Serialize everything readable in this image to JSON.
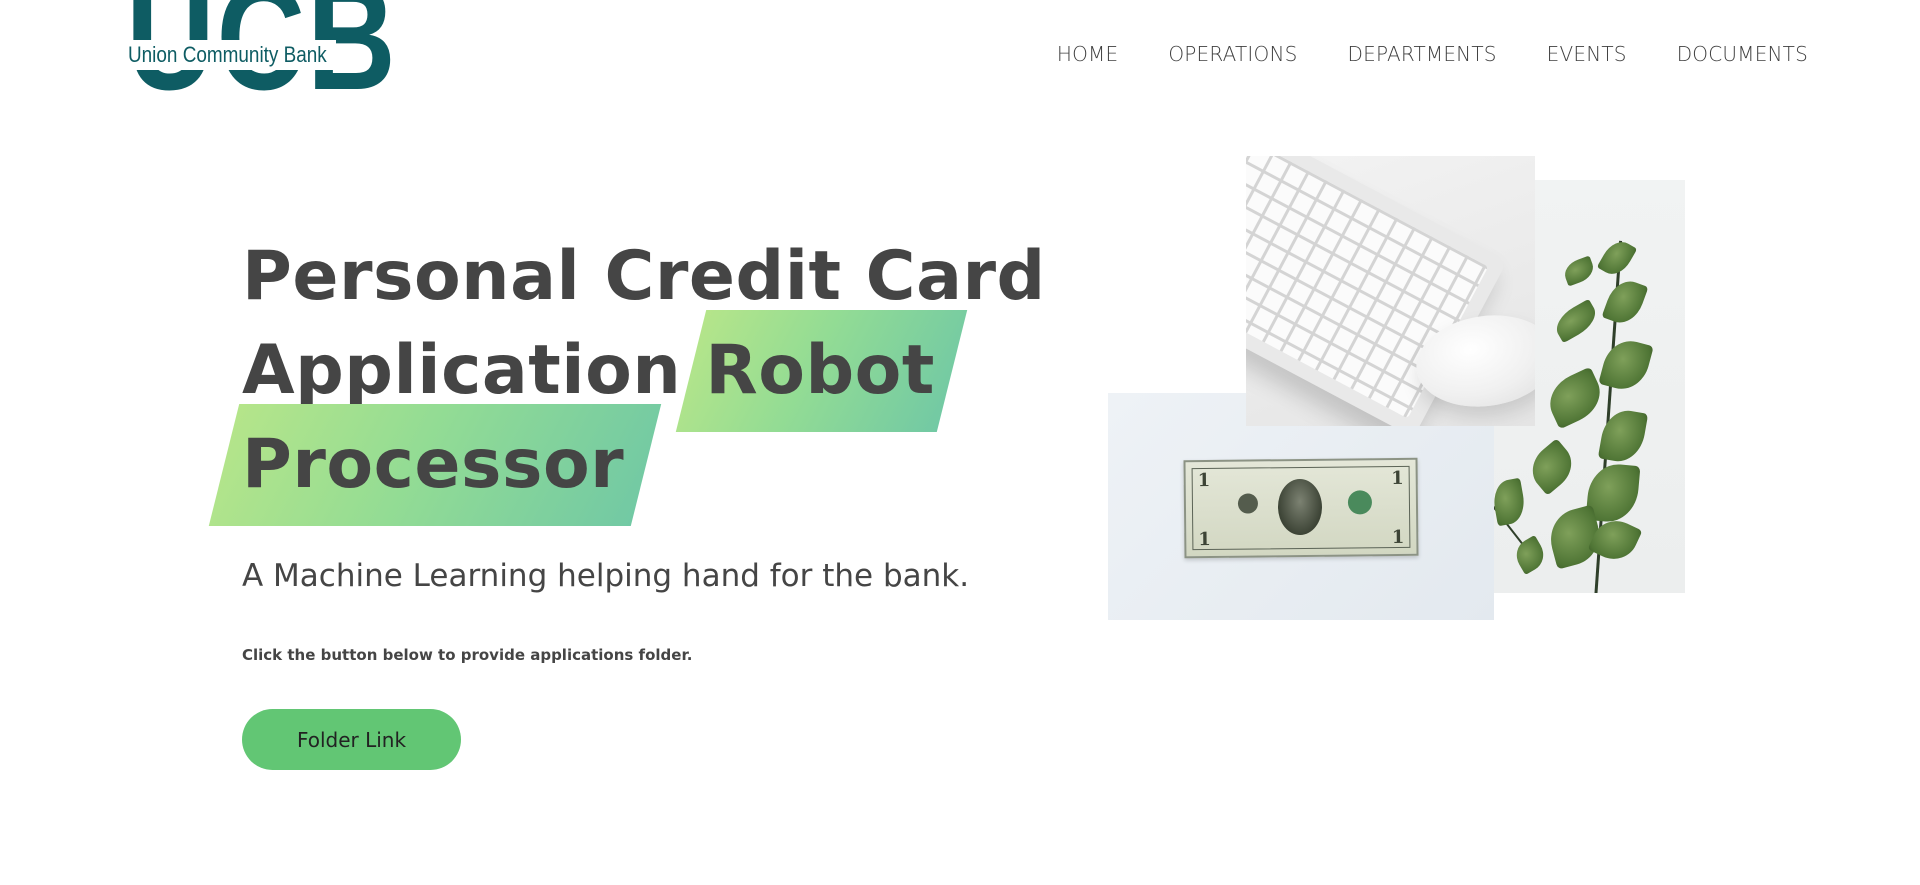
{
  "brand": {
    "logo_letters": "UCB",
    "bank_name": "Union Community Bank",
    "color": "#0e5c63"
  },
  "nav": {
    "items": [
      {
        "label": "HOME"
      },
      {
        "label": "OPERATIONS"
      },
      {
        "label": "DEPARTMENTS"
      },
      {
        "label": "EVENTS"
      },
      {
        "label": "DOCUMENTS"
      }
    ]
  },
  "hero": {
    "title_line1": "Personal Credit Card",
    "title_line2_plain": "Application",
    "title_line2_highlight": "Robot",
    "title_line3_highlight": "Processor",
    "subtitle": "A Machine Learning helping hand for the bank.",
    "hint": "Click the button below to provide applications folder.",
    "button_label": "Folder Link",
    "accent_color": "#62c674",
    "highlight_gradient": [
      "#b5e58a",
      "#72c9a4"
    ]
  },
  "collage": {
    "images": [
      {
        "name": "keyboard-and-mouse-photo"
      },
      {
        "name": "dollar-bill-photo"
      },
      {
        "name": "eucalyptus-plant-photo"
      }
    ]
  }
}
